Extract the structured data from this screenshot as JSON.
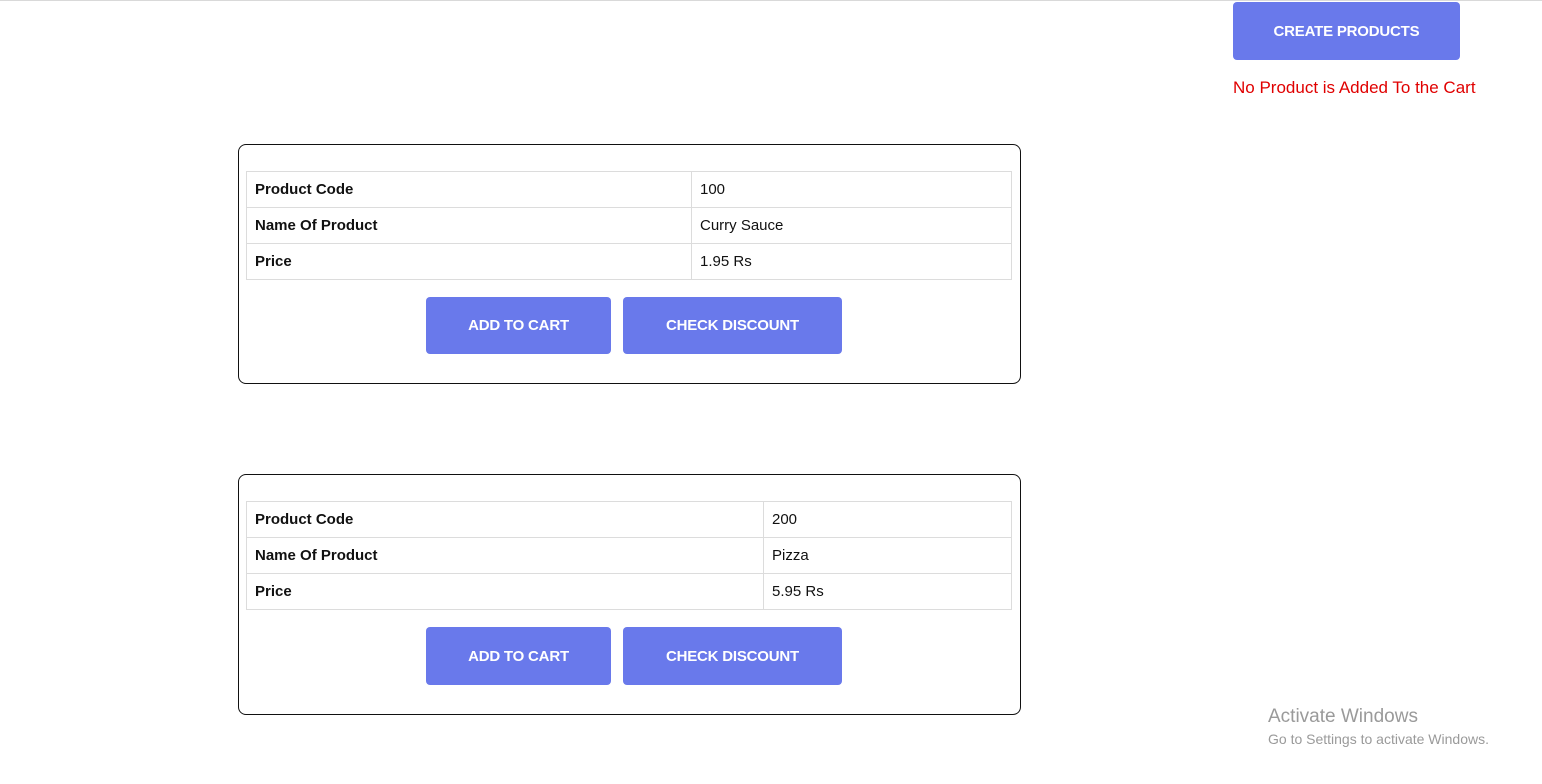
{
  "header": {
    "create_label": "CREATE PRODUCTS",
    "cart_status": "No Product is Added To the Cart"
  },
  "products": [
    {
      "rows": [
        {
          "label": "Product Code",
          "value": "100"
        },
        {
          "label": "Name Of Product",
          "value": "Curry Sauce"
        },
        {
          "label": "Price",
          "value": "1.95 Rs"
        }
      ],
      "add_label": "ADD TO CART",
      "discount_label": "CHECK DISCOUNT"
    },
    {
      "rows": [
        {
          "label": "Product Code",
          "value": "200"
        },
        {
          "label": "Name Of Product",
          "value": "Pizza"
        },
        {
          "label": "Price",
          "value": "5.95 Rs"
        }
      ],
      "add_label": "ADD TO CART",
      "discount_label": "CHECK DISCOUNT"
    }
  ],
  "watermark": {
    "title": "Activate Windows",
    "subtitle": "Go to Settings to activate Windows."
  },
  "colors": {
    "button_bg": "#6979eb",
    "status_text": "#e00000"
  }
}
